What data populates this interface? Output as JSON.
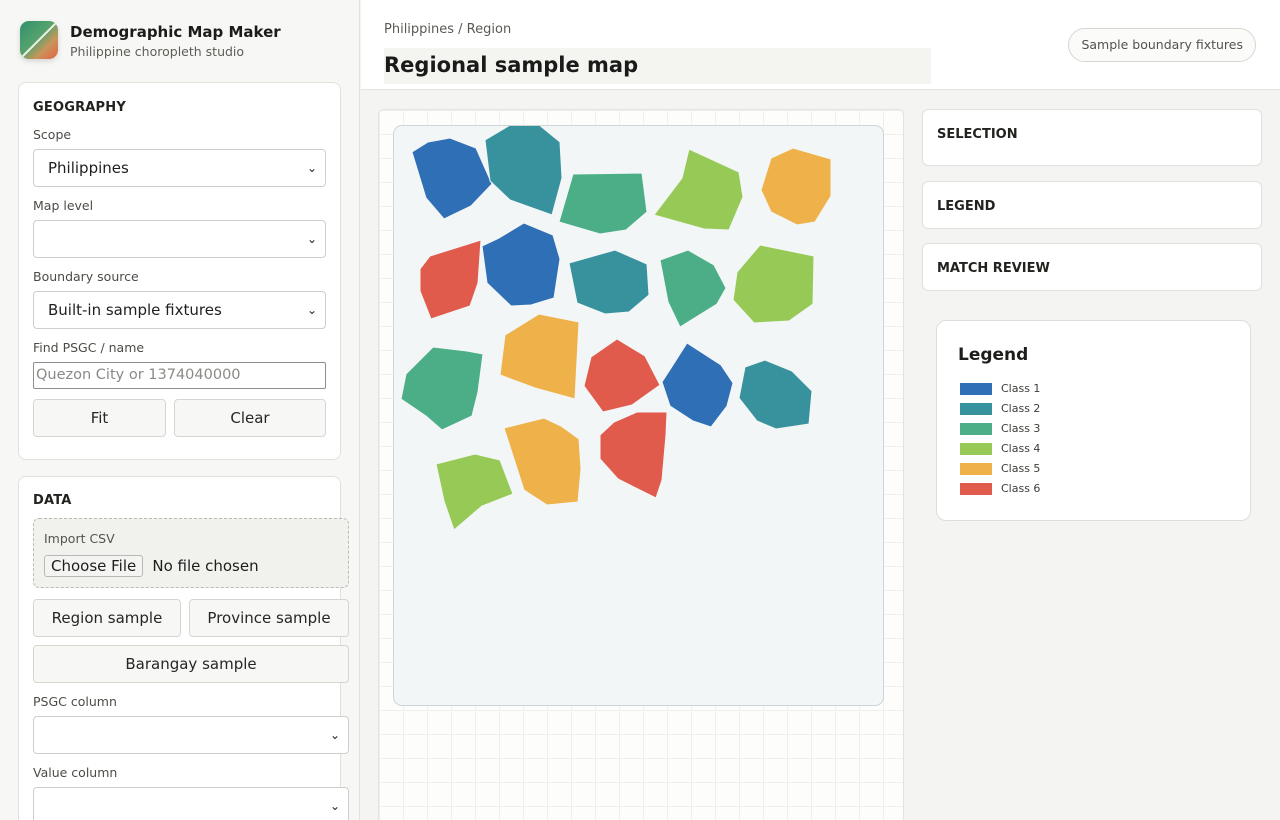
{
  "brand": {
    "title": "Demographic Map Maker",
    "subtitle": "Philippine choropleth studio",
    "logo_icon": "map-maker-logo-icon"
  },
  "geography": {
    "title": "GEOGRAPHY",
    "scope_label": "Scope",
    "scope_value": "Philippines",
    "map_level_label": "Map level",
    "map_level_value": "",
    "boundary_label": "Boundary source",
    "boundary_value": "Built-in sample fixtures",
    "find_label": "Find PSGC / name",
    "find_placeholder": "Quezon City or 1374040000",
    "fit_label": "Fit",
    "clear_label": "Clear",
    "select_icon": "chevron-down-icon"
  },
  "data": {
    "title": "DATA",
    "import_label": "Import CSV",
    "choose_file_label": "Choose File",
    "file_status": "No file chosen",
    "region_sample_label": "Region sample",
    "province_sample_label": "Province sample",
    "barangay_sample_label": "Barangay sample",
    "psgc_column_label": "PSGC column",
    "psgc_column_value": "",
    "value_column_label": "Value column",
    "value_column_value": ""
  },
  "header": {
    "breadcrumb": "Philippines / Region",
    "title": "Regional sample map",
    "badge": "Sample boundary fixtures"
  },
  "panels": {
    "selection_title": "SELECTION",
    "legend_title": "LEGEND",
    "match_review_title": "MATCH REVIEW"
  },
  "legend": {
    "title": "Legend",
    "classes": [
      {
        "label": "Class 1",
        "color": "#2f6fb5"
      },
      {
        "label": "Class 2",
        "color": "#37929d"
      },
      {
        "label": "Class 3",
        "color": "#4bae86"
      },
      {
        "label": "Class 4",
        "color": "#97c957"
      },
      {
        "label": "Class 5",
        "color": "#efb149"
      },
      {
        "label": "Class 6",
        "color": "#e05b4b"
      }
    ]
  },
  "map": {
    "background": "#f3f6f6",
    "region_classes": [
      1,
      2,
      3,
      4,
      5,
      6,
      1,
      2,
      3,
      4,
      5,
      6,
      1,
      2,
      3,
      4,
      5,
      6
    ]
  }
}
